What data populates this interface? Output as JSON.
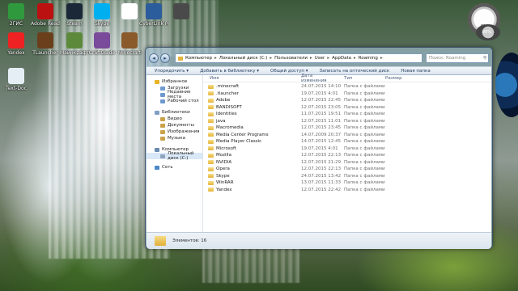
{
  "desktop": {
    "icons": [
      {
        "label": "2ГИС",
        "color": "#2f9a3d"
      },
      {
        "label": "Adobe Reader X",
        "color": "#b11"
      },
      {
        "label": "Steam",
        "color": "#1b2838"
      },
      {
        "label": "Skype",
        "color": "#00aff0"
      },
      {
        "label": "",
        "color": "#ffffff"
      },
      {
        "label": "CyberLink PowerDVD",
        "color": "#2b5c9b"
      },
      {
        "label": "",
        "color": "#4a4a4a"
      },
      {
        "label": "Yandex",
        "color": "#e22"
      },
      {
        "label": "TLauncher",
        "color": "#6b3f1c"
      },
      {
        "label": "Майнкрафт",
        "color": "#5c8a3a"
      },
      {
        "label": "CraftGuide",
        "color": "#7a4b9a"
      },
      {
        "label": "Minecraft",
        "color": "#8a5a2b"
      },
      {
        "label": "Text-Doc",
        "color": "#e6eef5"
      }
    ]
  },
  "gadgets": {
    "cpu_percent": "8%",
    "ram_percent": "98%"
  },
  "window": {
    "breadcrumbs": [
      "Компьютер",
      "Локальный диск (C:)",
      "Пользователи",
      "User",
      "AppData",
      "Roaming"
    ],
    "search_placeholder": "Поиск: Roaming",
    "toolbar": [
      "Упорядочить ▾",
      "Добавить в библиотеку ▾",
      "Общий доступ ▾",
      "Записать на оптический диск",
      "Новая папка"
    ],
    "nav": {
      "favorites": "Избранное",
      "favorites_items": [
        "Загрузки",
        "Недавние места",
        "Рабочий стол"
      ],
      "libraries": "Библиотеки",
      "libraries_items": [
        "Видео",
        "Документы",
        "Изображения",
        "Музыка"
      ],
      "computer": "Компьютер",
      "computer_items": [
        "Локальный диск (C:)"
      ],
      "network": "Сеть"
    },
    "columns": {
      "name": "Имя",
      "date": "Дата изменения",
      "type": "Тип",
      "size": "Размер"
    },
    "files": [
      {
        "name": ".minecraft",
        "date": "24.07.2015 14:10",
        "type": "Папка с файлами"
      },
      {
        "name": ".tlauncher",
        "date": "19.07.2015 4:01",
        "type": "Папка с файлами"
      },
      {
        "name": "Adobe",
        "date": "12.07.2015 22:45",
        "type": "Папка с файлами"
      },
      {
        "name": "BANDISOFT",
        "date": "12.07.2015 23:05",
        "type": "Папка с файлами"
      },
      {
        "name": "Identities",
        "date": "11.07.2015 19:51",
        "type": "Папка с файлами"
      },
      {
        "name": "java",
        "date": "12.07.2015 11:01",
        "type": "Папка с файлами"
      },
      {
        "name": "Macromedia",
        "date": "12.07.2015 23:45",
        "type": "Папка с файлами"
      },
      {
        "name": "Media Center Programs",
        "date": "14.07.2009 20:37",
        "type": "Папка с файлами"
      },
      {
        "name": "Media Player Classic",
        "date": "14.07.2015 12:45",
        "type": "Папка с файлами"
      },
      {
        "name": "Microsoft",
        "date": "19.07.2015 4:01",
        "type": "Папка с файлами"
      },
      {
        "name": "Mozilla",
        "date": "12.07.2015 22:13",
        "type": "Папка с файлами"
      },
      {
        "name": "NVIDIA",
        "date": "12.07.2015 21:29",
        "type": "Папка с файлами"
      },
      {
        "name": "Opera",
        "date": "12.07.2015 22:13",
        "type": "Папка с файлами"
      },
      {
        "name": "Skype",
        "date": "24.07.2015 13:42",
        "type": "Папка с файлами"
      },
      {
        "name": "WinRAR",
        "date": "13.07.2015 11:33",
        "type": "Папка с файлами"
      },
      {
        "name": "Yandex",
        "date": "12.07.2015 22:42",
        "type": "Папка с файлами"
      }
    ],
    "status": "Элементов: 16"
  }
}
